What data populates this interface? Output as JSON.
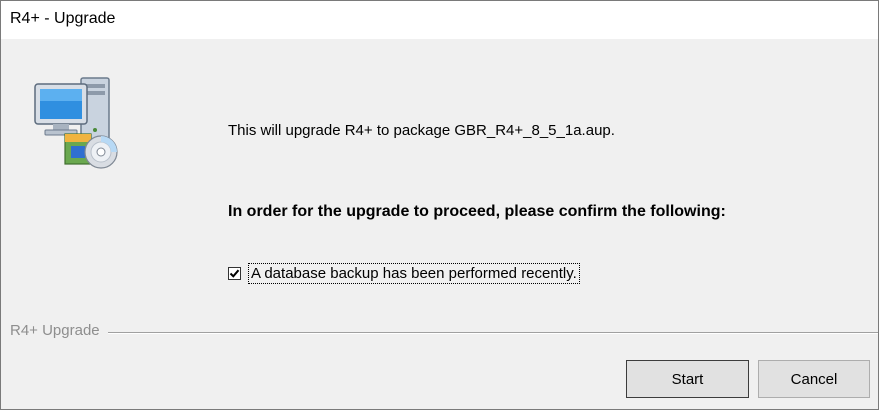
{
  "window": {
    "title": "R4+ - Upgrade"
  },
  "icons": {
    "app_icon": "computer-with-installer-disc-icon",
    "checkbox_state": "checked"
  },
  "main": {
    "info_text": "This will upgrade R4+ to package GBR_R4+_8_5_1a.aup.",
    "confirm_heading": "In order for the upgrade to proceed, please confirm the following:",
    "backup_checkbox": {
      "label": "A database backup has been performed recently.",
      "checked": true
    }
  },
  "footer": {
    "group_label": "R4+ Upgrade",
    "start_label": "Start",
    "cancel_label": "Cancel"
  }
}
